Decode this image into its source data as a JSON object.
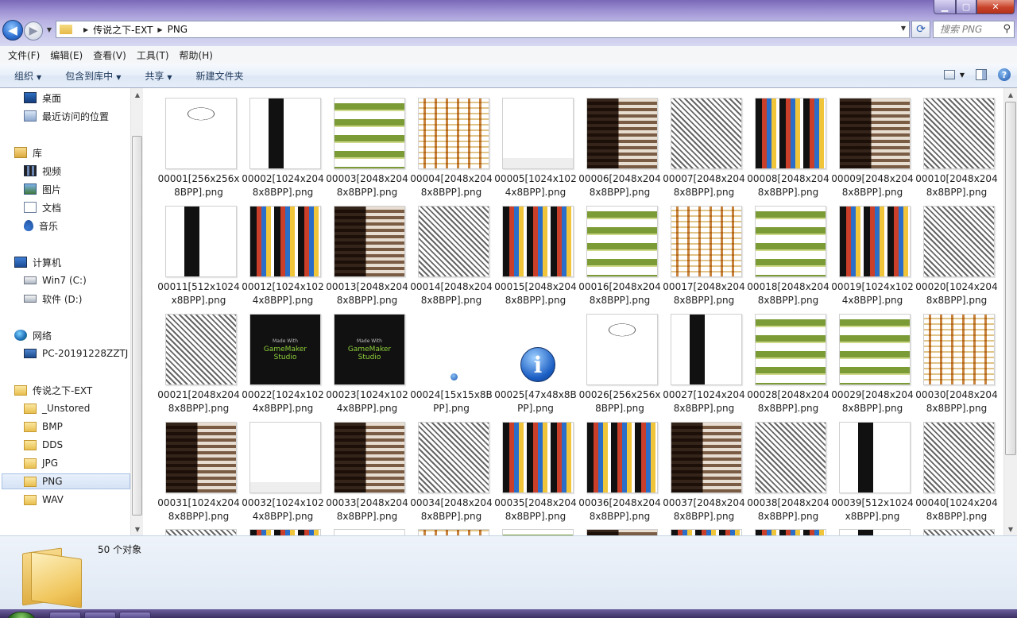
{
  "address": {
    "crumbs": [
      "传说之下-EXT",
      "PNG"
    ]
  },
  "search": {
    "placeholder": "搜索 PNG"
  },
  "menubar": [
    "文件(F)",
    "编辑(E)",
    "查看(V)",
    "工具(T)",
    "帮助(H)"
  ],
  "toolbar": {
    "organize": "组织",
    "include_in_library": "包含到库中",
    "share": "共享",
    "new_folder": "新建文件夹"
  },
  "nav": {
    "desktop": "桌面",
    "recent": "最近访问的位置",
    "libraries": "库",
    "videos": "视频",
    "pictures": "图片",
    "documents": "文档",
    "music": "音乐",
    "computer": "计算机",
    "drive_c": "Win7 (C:)",
    "drive_d": "软件 (D:)",
    "network": "网络",
    "network_host": "PC-20191228ZZTJ",
    "root_folder": "传说之下-EXT",
    "subfolders": [
      "_Unstored",
      "BMP",
      "DDS",
      "JPG",
      "PNG",
      "WAV"
    ]
  },
  "files": [
    {
      "name": "00001[256x256x8BPP].png",
      "thumb": "mask"
    },
    {
      "name": "00002[1024x2048x8BPP].png",
      "thumb": "tall"
    },
    {
      "name": "00003[2048x2048x8BPP].png",
      "thumb": "green"
    },
    {
      "name": "00004[2048x2048x8BPP].png",
      "thumb": "sprite"
    },
    {
      "name": "00005[1024x1024x8BPP].png",
      "thumb": "blank"
    },
    {
      "name": "00006[2048x2048x8BPP].png",
      "thumb": "mixdark"
    },
    {
      "name": "00007[2048x2048x8BPP].png",
      "thumb": "mono"
    },
    {
      "name": "00008[2048x2048x8BPP].png",
      "thumb": "colorful"
    },
    {
      "name": "00009[2048x2048x8BPP].png",
      "thumb": "mixdark"
    },
    {
      "name": "00010[2048x2048x8BPP].png",
      "thumb": "mono"
    },
    {
      "name": "00011[512x1024x8BPP].png",
      "thumb": "tall"
    },
    {
      "name": "00012[1024x1024x8BPP].png",
      "thumb": "colorful"
    },
    {
      "name": "00013[2048x2048x8BPP].png",
      "thumb": "mixdark"
    },
    {
      "name": "00014[2048x2048x8BPP].png",
      "thumb": "mono"
    },
    {
      "name": "00015[2048x2048x8BPP].png",
      "thumb": "colorful"
    },
    {
      "name": "00016[2048x2048x8BPP].png",
      "thumb": "green"
    },
    {
      "name": "00017[2048x2048x8BPP].png",
      "thumb": "sprite"
    },
    {
      "name": "00018[2048x2048x8BPP].png",
      "thumb": "green"
    },
    {
      "name": "00019[1024x1024x8BPP].png",
      "thumb": "colorful"
    },
    {
      "name": "00020[1024x2048x8BPP].png",
      "thumb": "mono"
    },
    {
      "name": "00021[2048x2048x8BPP].png",
      "thumb": "mono"
    },
    {
      "name": "00022[1024x1024x8BPP].png",
      "thumb": "gms",
      "text": [
        "Made With",
        "GameMaker",
        "Studio"
      ]
    },
    {
      "name": "00023[1024x1024x8BPP].png",
      "thumb": "gms",
      "text": [
        "Made With",
        "GameMaker",
        "Studio"
      ]
    },
    {
      "name": "00024[15x15x8BPP].png",
      "thumb": "icon15"
    },
    {
      "name": "00025[47x48x8BPP].png",
      "thumb": "info"
    },
    {
      "name": "00026[256x256x8BPP].png",
      "thumb": "mask"
    },
    {
      "name": "00027[1024x2048x8BPP].png",
      "thumb": "tall"
    },
    {
      "name": "00028[2048x2048x8BPP].png",
      "thumb": "green"
    },
    {
      "name": "00029[2048x2048x8BPP].png",
      "thumb": "green"
    },
    {
      "name": "00030[2048x2048x8BPP].png",
      "thumb": "sprite"
    },
    {
      "name": "00031[1024x2048x8BPP].png",
      "thumb": "mixdark"
    },
    {
      "name": "00032[1024x1024x8BPP].png",
      "thumb": "blank"
    },
    {
      "name": "00033[2048x2048x8BPP].png",
      "thumb": "mixdark"
    },
    {
      "name": "00034[2048x2048x8BPP].png",
      "thumb": "mono"
    },
    {
      "name": "00035[2048x2048x8BPP].png",
      "thumb": "colorful"
    },
    {
      "name": "00036[2048x2048x8BPP].png",
      "thumb": "colorful"
    },
    {
      "name": "00037[2048x2048x8BPP].png",
      "thumb": "mixdark"
    },
    {
      "name": "00038[2048x2048x8BPP].png",
      "thumb": "mono"
    },
    {
      "name": "00039[512x1024x8BPP].png",
      "thumb": "tall"
    },
    {
      "name": "00040[1024x2048x8BPP].png",
      "thumb": "mono"
    }
  ],
  "status": {
    "object_count": "50 个对象"
  }
}
